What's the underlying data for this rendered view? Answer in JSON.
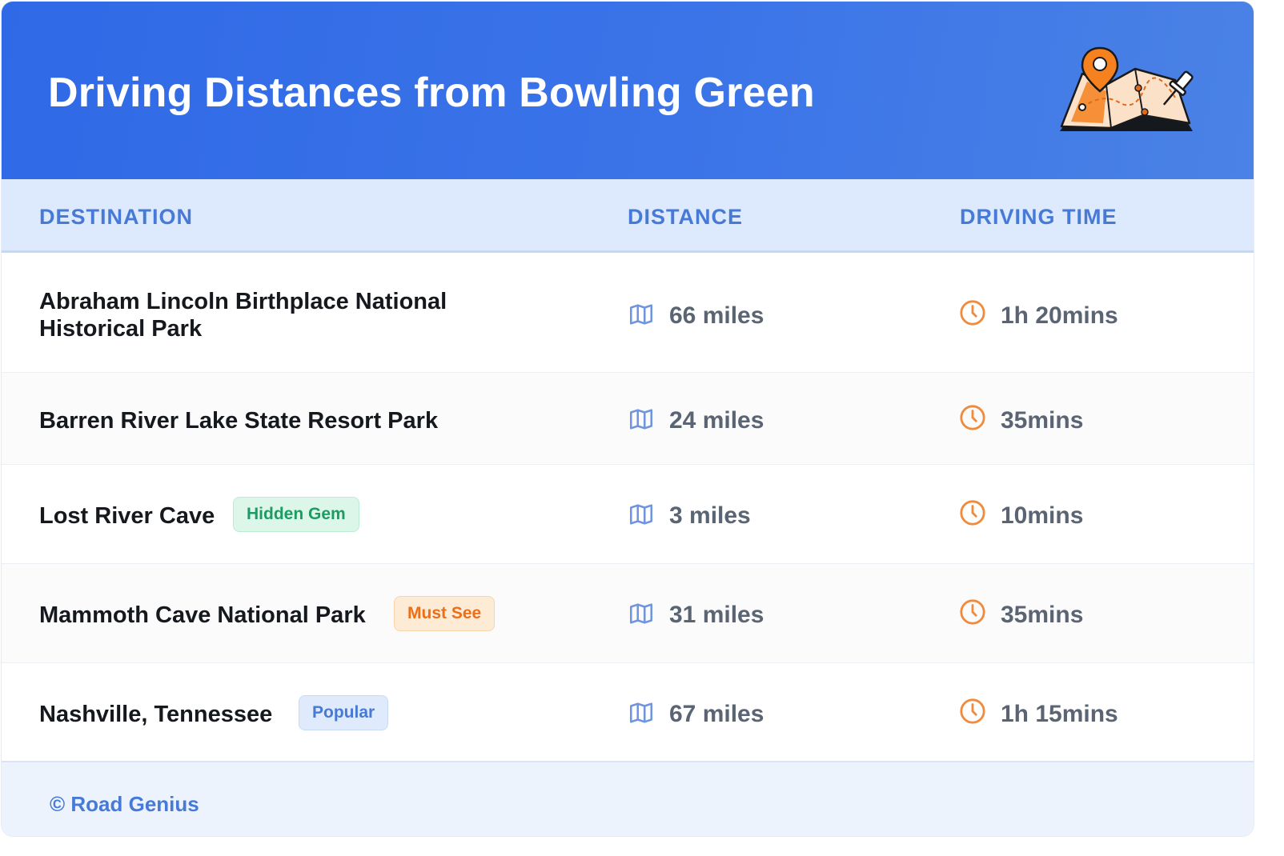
{
  "header": {
    "title": "Driving Distances from Bowling Green",
    "illustration_icon": "map-pin-icon"
  },
  "table": {
    "columns": [
      "DESTINATION",
      "DISTANCE",
      "DRIVING TIME"
    ],
    "rows": [
      {
        "destination": "Abraham Lincoln Birthplace National\nHistorical Park",
        "badge": "",
        "distance": "66 miles",
        "time": "1h 20mins"
      },
      {
        "destination": "Barren River Lake State Resort Park",
        "badge": "",
        "distance": "24 miles",
        "time": "35mins"
      },
      {
        "destination": "Lost River Cave",
        "badge": "Hidden Gem",
        "distance": "3 miles",
        "time": "10mins"
      },
      {
        "destination": "Mammoth Cave National Park",
        "badge": "Must See",
        "distance": "31 miles",
        "time": "35mins"
      },
      {
        "destination": "Nashville, Tennessee",
        "badge": "Popular",
        "distance": "67 miles",
        "time": "1h 15mins"
      }
    ]
  },
  "icons": {
    "distance": "map-icon",
    "time": "clock-icon"
  },
  "colors": {
    "header_blue": "#2f69e6",
    "accent_blue": "#4779d6",
    "clock_orange": "#f08a3c"
  },
  "footer": {
    "text": "© Road Genius"
  }
}
